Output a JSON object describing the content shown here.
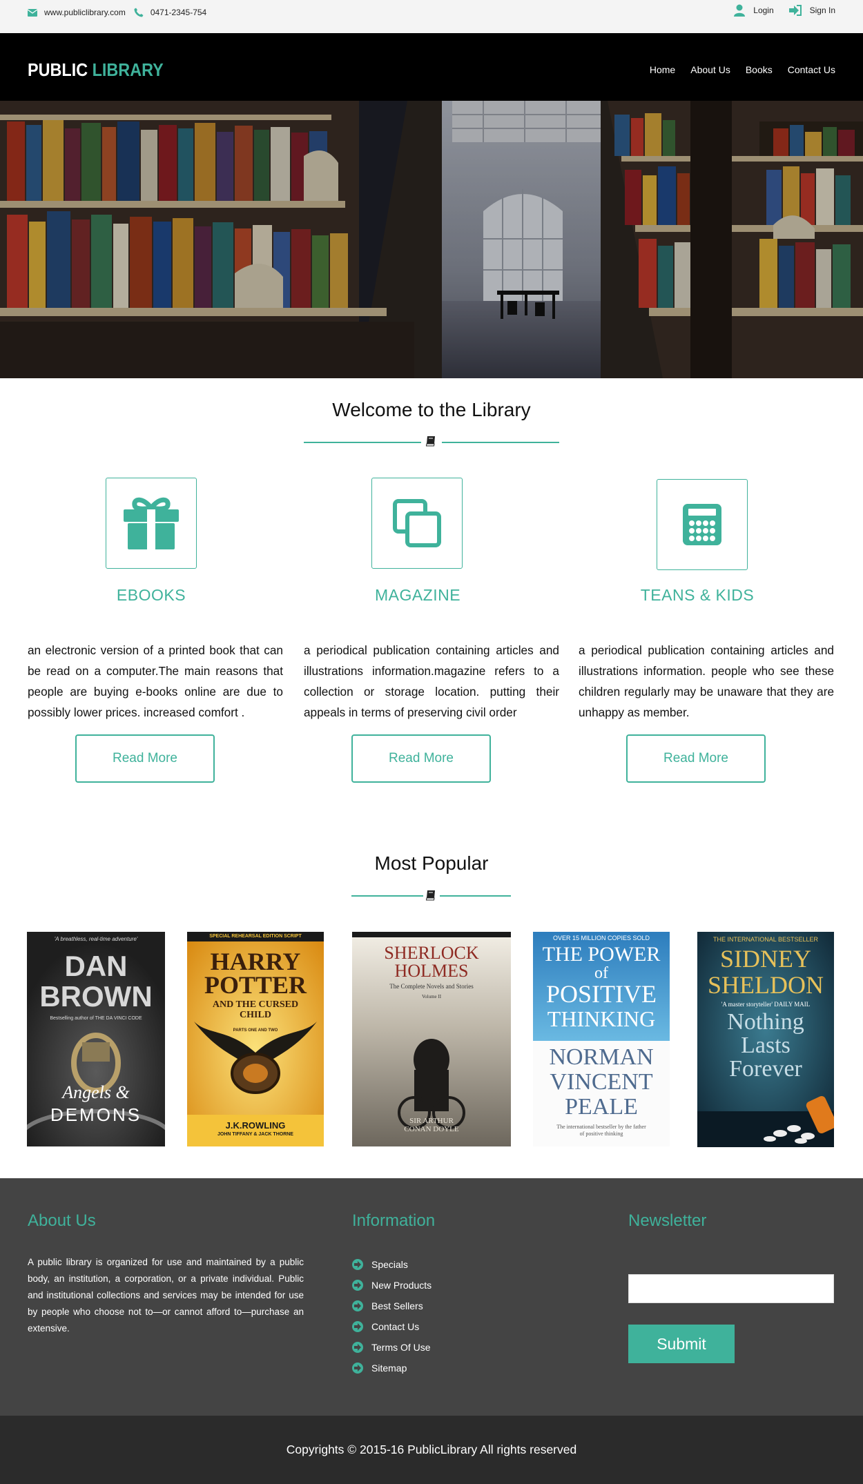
{
  "topbar": {
    "email": "www.publiclibrary.com",
    "phone": "0471-2345-754",
    "login": "Login",
    "signin": "Sign In"
  },
  "brand": {
    "first": "PUBLIC",
    "second": "LIBRARY"
  },
  "nav": {
    "items": [
      "Home",
      "About Us",
      "Books",
      "Contact Us"
    ]
  },
  "hero": {
    "slides": 3,
    "active": 2
  },
  "welcome": {
    "title": "Welcome to the Library"
  },
  "features": [
    {
      "icon": "gift-icon",
      "title": "EBOOKS",
      "text": "an electronic version of a printed book that can be read on a computer.The main reasons that people are buying e-books online are due to possibly lower prices. increased comfort .",
      "button": "Read More"
    },
    {
      "icon": "copy-icon",
      "title": "MAGAZINE",
      "text": "a periodical publication containing articles and illustrations information.magazine refers to a collection or storage location. putting their appeals in terms of preserving civil order",
      "button": "Read More"
    },
    {
      "icon": "calculator-icon",
      "title": "TEANS & KIDS",
      "text": "a periodical publication containing articles and illustrations information. people who see these children regularly may be unaware that they are unhappy as member.",
      "button": "Read More"
    }
  ],
  "popular": {
    "title": "Most Popular",
    "books": [
      {
        "tagline": "'A breathless, real-time adventure'",
        "author": "DAN BROWN",
        "line": "Bestselling author of THE DA VINCI CODE",
        "title1": "Angels &",
        "title2": "DEMONS"
      },
      {
        "tagline": "SPECIAL REHEARSAL EDITION SCRIPT",
        "title1": "HARRY POTTER",
        "line": "AND THE CURSED CHILD",
        "sub": "PARTS ONE AND TWO",
        "author": "J.K.ROWLING",
        "credit": "JOHN TIFFANY & JACK THORNE"
      },
      {
        "title1": "SHERLOCK",
        "title2": "HOLMES",
        "line": "The Complete Novels and Stories",
        "sub": "Volume II",
        "author": "SIR ARTHUR CONAN DOYLE"
      },
      {
        "tagline": "OVER 15 MILLION COPIES SOLD",
        "title1": "THE POWER",
        "title2": "of",
        "title3": "POSITIVE",
        "title4": "THINKING",
        "author": "NORMAN VINCENT PEALE",
        "line": "The international bestseller by the father of positive thinking"
      },
      {
        "tagline": "THE INTERNATIONAL BESTSELLER",
        "author": "SIDNEY SHELDON",
        "line": "'A master storyteller' DAILY MAIL",
        "title1": "Nothing",
        "title2": "Lasts",
        "title3": "Forever"
      }
    ]
  },
  "footer": {
    "about_title": "About Us",
    "about_text": "A public library is organized for use and maintained by a public body, an institution, a corporation, or a private individual. Public and institutional collections and services may be intended for use by people who choose not to—or cannot afford to—purchase an extensive.",
    "info_title": "Information",
    "links": [
      "Specials",
      "New Products",
      "Best Sellers",
      "Contact Us",
      "Terms Of Use",
      "Sitemap"
    ],
    "newsletter_title": "Newsletter",
    "newsletter_placeholder": "",
    "submit": "Submit"
  },
  "copyright": "Copyrights © 2015-16 PublicLibrary All rights reserved",
  "colors": {
    "accent": "#3fb29b",
    "nav": "#000000",
    "footer": "#444444",
    "copyright_bg": "#2b2b2b"
  }
}
